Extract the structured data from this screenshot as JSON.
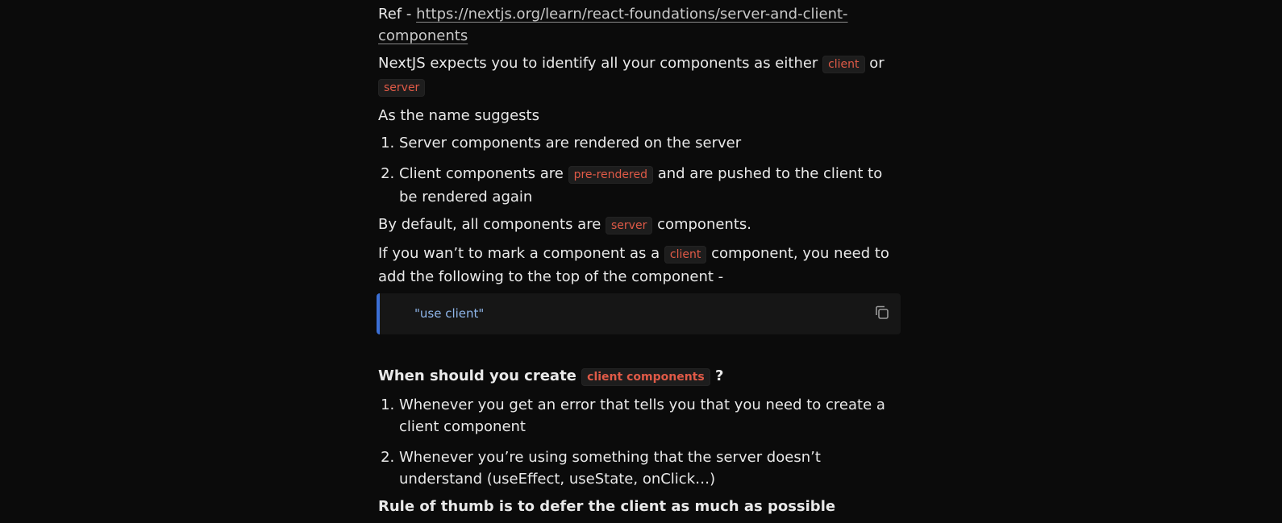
{
  "ref": {
    "prefix": "Ref - ",
    "link_text": "https://nextjs.org/learn/react-foundations/server-and-client-components"
  },
  "intro": {
    "text_before": "NextJS expects you to identify all your components as either ",
    "code_client": "client",
    "text_or": " or ",
    "code_server": "server"
  },
  "name_suggests": "As the name suggests",
  "list1": {
    "item1": "Server components are rendered on the server",
    "item2_before": "Client components are ",
    "item2_code": "pre-rendered",
    "item2_after": " and are pushed to the client to be rendered again"
  },
  "default_line": {
    "before": "By default, all components are ",
    "code": "server",
    "after": " components."
  },
  "mark_line": {
    "before": "If you wan’t to mark a component as a ",
    "code": "client",
    "after": " component, you need to add the following to the top of the component -"
  },
  "codeblock": {
    "code": "\"use client\"",
    "copy_icon": "copy-icon"
  },
  "heading2": {
    "before": "When should you create ",
    "code": "client components",
    "after": " ?"
  },
  "list2": {
    "item1": "Whenever you get an error that tells you that you need to create a client component",
    "item2": "Whenever you’re using something that the server doesn’t understand (useEffect, useState, onClick…)"
  },
  "rule": "Rule of thumb is to defer the client as much as possible",
  "colors": {
    "background": "#0b0b0b",
    "text": "#e9e9e9",
    "inline_code": "#e05a47",
    "code_accent": "#3b6fd6",
    "code_text": "#8fb6ea"
  }
}
